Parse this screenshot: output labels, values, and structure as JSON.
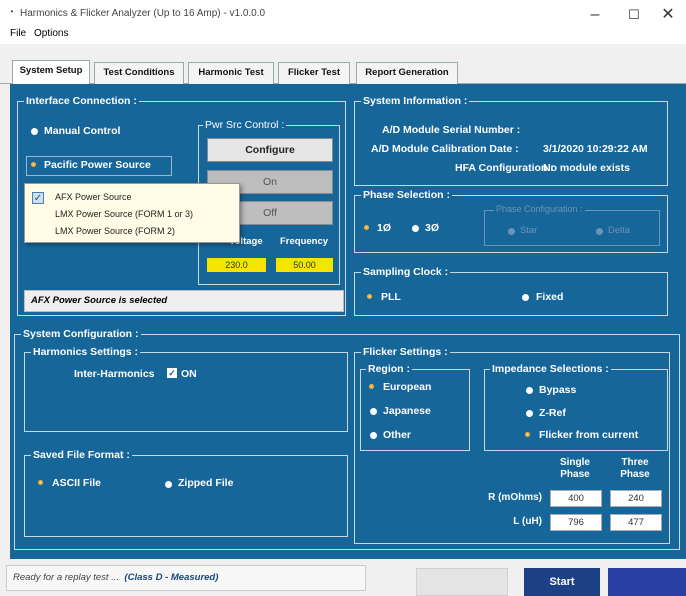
{
  "window": {
    "title": "Harmonics & Flicker Analyzer (Up to 16 Amp) - v1.0.0.0",
    "app_icon": "gauge-icon",
    "controls": [
      "–",
      "☐",
      "✕"
    ]
  },
  "menu": [
    "File",
    "Options"
  ],
  "tabs": [
    "System Setup",
    "Test Conditions",
    "Harmonic Test",
    "Flicker Test",
    "Report Generation"
  ],
  "interface": {
    "label": "Interface Connection :",
    "manual": "Manual Control",
    "pacific": "Pacific Power Source",
    "dropdown": [
      "AFX Power Source",
      "LMX Power Source (FORM 1 or 3)",
      "LMX Power Source (FORM 2)"
    ],
    "status": "AFX Power Source is selected"
  },
  "pwr": {
    "label": "Pwr Src Control :",
    "configure": "Configure",
    "on": "On",
    "off": "Off",
    "voltage_label": "Voltage",
    "frequency_label": "Frequency",
    "voltage": "230.0",
    "frequency": "50.00"
  },
  "sysinfo": {
    "label": "System Information :",
    "serial_label": "A/D Module Serial Number :",
    "cal_label": "A/D Module Calibration Date :",
    "cal_value": "3/1/2020  10:29:22 AM",
    "hfa_label": "HFA Configuration :",
    "hfa_value": "No module exists"
  },
  "phase": {
    "label": "Phase Selection :",
    "one": "1Ø",
    "three": "3Ø",
    "config_label": "Phase Configuration :",
    "star": "Star",
    "delta": "Delta"
  },
  "sampling": {
    "label": "Sampling Clock :",
    "pll": "PLL",
    "fixed": "Fixed"
  },
  "sysconfig": {
    "label": "System Configuration :"
  },
  "harmonics": {
    "label": "Harmonics Settings :",
    "inter": "Inter-Harmonics",
    "on": "ON"
  },
  "saved": {
    "label": "Saved File Format :",
    "ascii": "ASCII File",
    "zipped": "Zipped File"
  },
  "flicker": {
    "label": "Flicker Settings :",
    "region_label": "Region :",
    "european": "European",
    "japanese": "Japanese",
    "other": "Other",
    "imp_label": "Impedance Selections :",
    "bypass": "Bypass",
    "zref": "Z-Ref",
    "from_current": "Flicker from current",
    "single": "Single\nPhase",
    "three_ph": "Three\nPhase",
    "r_label": "R (mOhms)",
    "l_label": "L (uH)",
    "r_single": "400",
    "r_three": "240",
    "l_single": "796",
    "l_three": "477"
  },
  "statusbar": {
    "text": "Ready for a replay test ...",
    "detail": "(Class D - Measured)"
  },
  "buttons": {
    "start": "Start"
  },
  "colors": {
    "panel": "#17669a",
    "accent_yellow": "#f6e400",
    "start_btn": "#1d3f86"
  }
}
